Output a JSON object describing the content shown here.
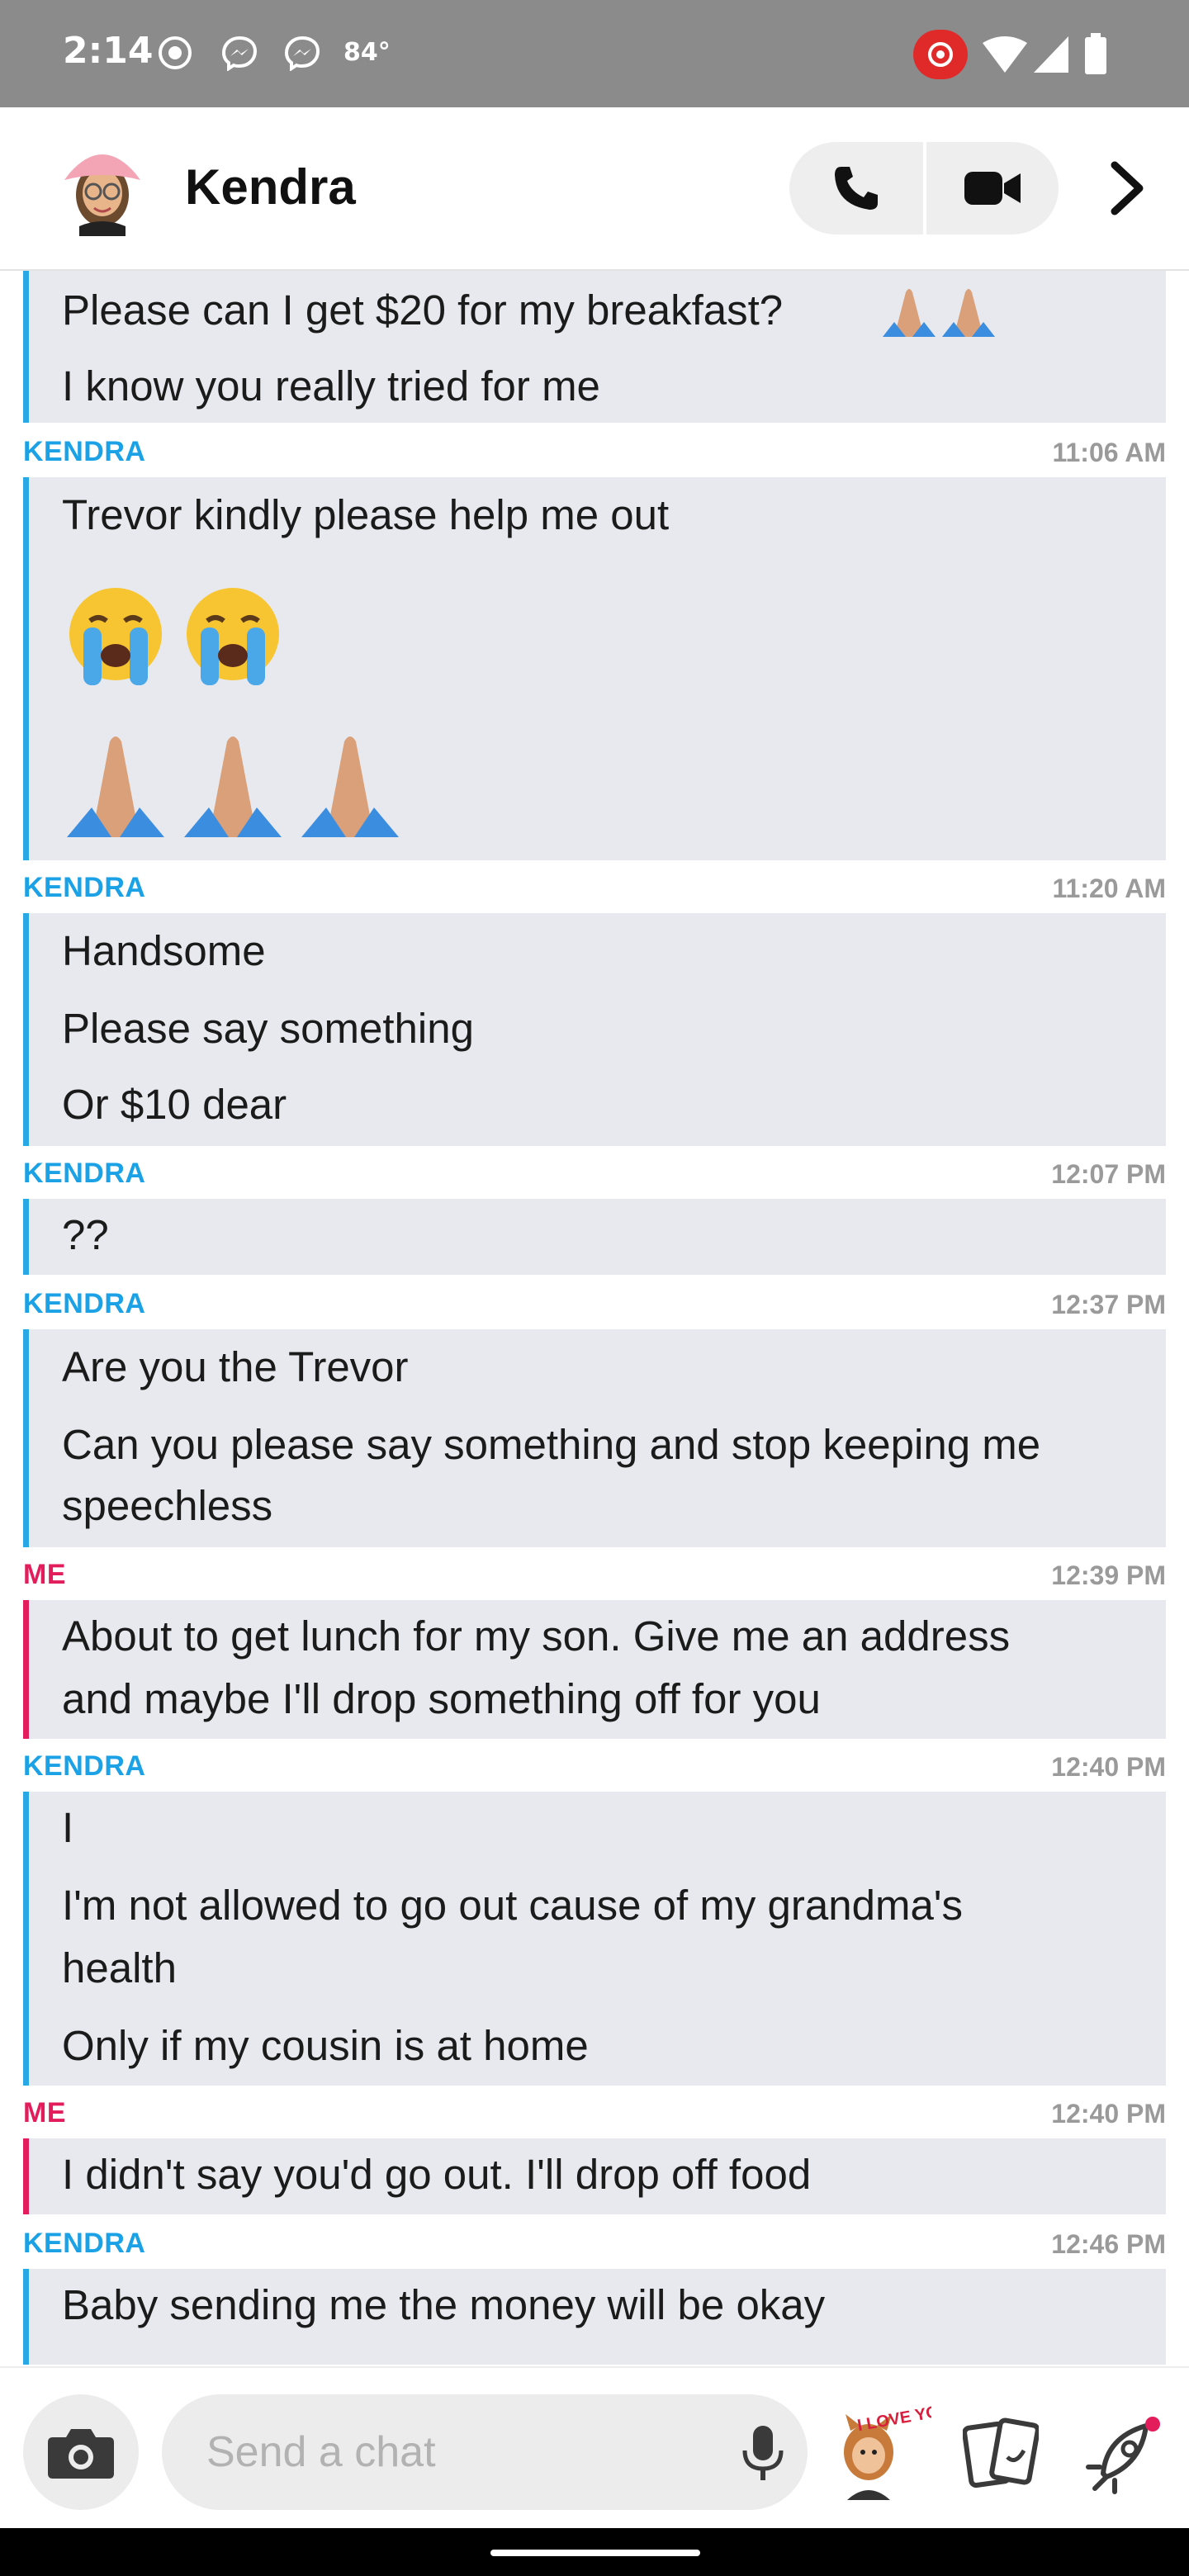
{
  "status_bar": {
    "time": "2:14",
    "temperature": "84°",
    "icons": [
      "screen-record-icon",
      "messenger-icon",
      "messenger-icon",
      "hotspot-icon",
      "wifi-icon",
      "signal-icon",
      "battery-icon"
    ]
  },
  "header": {
    "contact_name": "Kendra",
    "icons": [
      "avatar",
      "phone-icon",
      "video-icon",
      "chevron-right-icon"
    ]
  },
  "colors": {
    "kendra": "#1aa1e6",
    "me": "#e31d5b",
    "bubble_bg": "#e8e9ee",
    "status_bar": "#8b8b8b"
  },
  "messages": {
    "b0": {
      "lines": [
        "Please can I get $20 for my breakfast?",
        "I know you really tried for me"
      ]
    },
    "h1": {
      "sender": "KENDRA",
      "time": "11:06 AM"
    },
    "b1": {
      "lines": [
        "Trevor kindly please help me out"
      ],
      "emoji": [
        "crying-face-icon",
        "crying-face-icon",
        "folded-hands-icon",
        "folded-hands-icon",
        "folded-hands-icon"
      ]
    },
    "h2": {
      "sender": "KENDRA",
      "time": "11:20 AM"
    },
    "b2": {
      "lines": [
        "Handsome",
        "Please say something",
        "Or $10 dear"
      ]
    },
    "h3": {
      "sender": "KENDRA",
      "time": "12:07 PM"
    },
    "b3": {
      "lines": [
        "??"
      ]
    },
    "h4": {
      "sender": "KENDRA",
      "time": "12:37 PM"
    },
    "b4": {
      "lines": [
        "Are you the Trevor",
        "Can you please say something and stop keeping me",
        "speechless"
      ]
    },
    "h5": {
      "sender": "ME",
      "time": "12:39 PM"
    },
    "b5": {
      "lines": [
        "About to get lunch for my son. Give me an address",
        "and maybe I'll drop something off for you"
      ]
    },
    "h6": {
      "sender": "KENDRA",
      "time": "12:40 PM"
    },
    "b6": {
      "lines": [
        "I",
        "I'm not allowed to go out cause of my grandma's",
        "health",
        "Only if my cousin is at home"
      ]
    },
    "h7": {
      "sender": "ME",
      "time": "12:40 PM"
    },
    "b7": {
      "lines": [
        "I didn't say you'd go out. I'll drop off food"
      ]
    },
    "h8": {
      "sender": "KENDRA",
      "time": "12:46 PM"
    },
    "b8": {
      "lines": [
        "Baby sending me the money will be okay"
      ]
    }
  },
  "composer": {
    "placeholder": "Send a chat",
    "sticker_text": "I LOVE YOU",
    "icons": [
      "camera-icon",
      "microphone-icon",
      "bitmoji-sticker",
      "cards-icon",
      "rocket-icon"
    ]
  }
}
